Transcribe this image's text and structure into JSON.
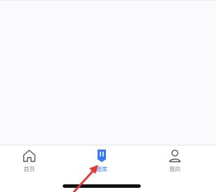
{
  "tabbar": {
    "items": [
      {
        "label": "首页",
        "icon": "home-icon",
        "selected": false
      },
      {
        "label": "题库",
        "icon": "question-bank-icon",
        "selected": true
      },
      {
        "label": "我的",
        "icon": "user-icon",
        "selected": false
      }
    ]
  },
  "colors": {
    "accent": "#3478f6",
    "inactive": "#888888",
    "annotation_arrow": "#e53935"
  }
}
